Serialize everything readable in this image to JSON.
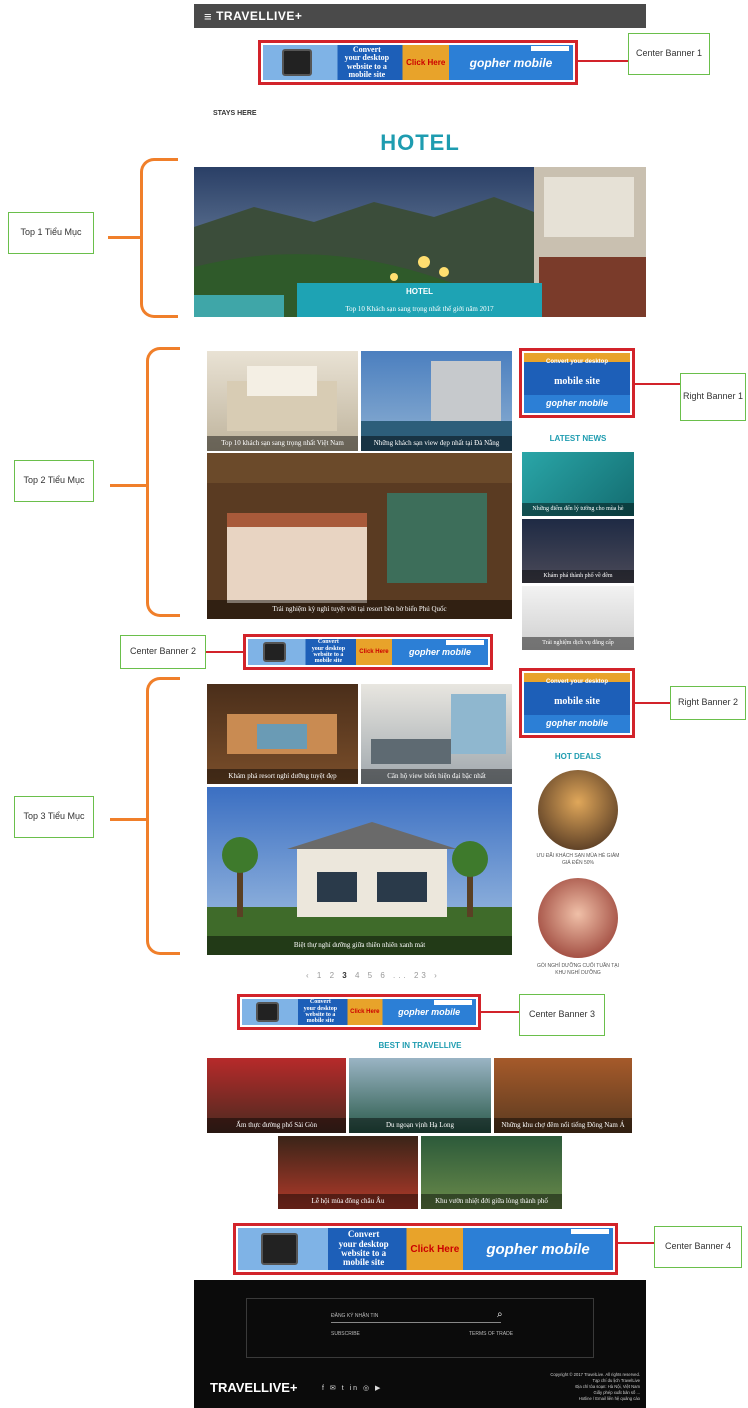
{
  "header": {
    "menu_icon": "hamburger-icon",
    "logo": "TRAVELLIVE+"
  },
  "banner": {
    "line1": "Convert",
    "line2": "your desktop",
    "line3": "website to a",
    "line4": "mobile site",
    "click": "Click Here",
    "brand": "gopher mobile"
  },
  "right_banner": {
    "line1": "Convert your desktop",
    "line2": "mobile site",
    "brand": "gopher mobile"
  },
  "callouts": {
    "center1": "Center Banner 1",
    "center2": "Center Banner 2",
    "center3": "Center Banner 3",
    "center4": "Center Banner 4",
    "right1": "Right Banner 1",
    "right2": "Right Banner 2",
    "top1": "Top 1 Tiểu Mục",
    "top2": "Top 2 Tiểu Mục",
    "top3": "Top 3 Tiểu Mục"
  },
  "section": {
    "breadcrumb": "STAYS HERE",
    "title": "HOTEL"
  },
  "hero": {
    "label": "HOTEL",
    "caption": "Top 10 Khách sạn sang trọng nhất thế giới năm 2017"
  },
  "top2": {
    "tile1": "Top 10 khách sạn sang trọng nhất Việt Nam",
    "tile2": "Những khách sạn view đẹp nhất tại Đà Nẵng",
    "tile3": "Trải nghiệm kỳ nghỉ tuyệt vời tại resort bên bờ biển Phú Quốc"
  },
  "latest": {
    "title": "LATEST NEWS",
    "item1": "Những điểm đến lý tưởng cho mùa hè",
    "item2": "Khám phá thành phố về đêm",
    "item3": "Trải nghiệm dịch vụ đẳng cấp"
  },
  "top3": {
    "tile1": "Khám phá resort nghỉ dưỡng tuyệt đẹp",
    "tile2": "Căn hộ view biển hiện đại bậc nhất",
    "tile3": "Biệt thự nghỉ dưỡng giữa thiên nhiên xanh mát"
  },
  "deals": {
    "title": "HOT DEALS",
    "item1": "ƯU ĐÃI KHÁCH SẠN MÙA HÈ GIẢM GIÁ ĐẾN 50%",
    "item2": "GÓI NGHỈ DƯỠNG CUỐI TUẦN TẠI KHU NGHỈ DƯỠNG"
  },
  "pager": {
    "prev": "‹",
    "p1": "1",
    "p2": "2",
    "p3": "3",
    "p4": "4",
    "p5": "5",
    "p6": "6",
    "dots": "...",
    "last": "23",
    "next": "›"
  },
  "best": {
    "title": "BEST IN TRAVELLIVE",
    "item1": "Ẩm thực đường phố Sài Gòn",
    "item2": "Du ngoạn vịnh Hạ Long",
    "item3": "Những khu chợ đêm nổi tiếng Đông Nam Á",
    "item4": "Lễ hội mùa đông châu Âu",
    "item5": "Khu vườn nhiệt đới giữa lòng thành phố"
  },
  "footer": {
    "search_placeholder": "ĐĂNG KÝ NHẬN TIN",
    "search_icon": "search-icon",
    "link1": "SUBSCRIBE",
    "link2": "TERMS OF TRADE",
    "logo": "TRAVELLIVE+",
    "social": "f ✉ t in ◎ ▶",
    "legal1": "Copyright © 2017 TravelLive. All rights reserved.",
    "legal2": "Tạp chí du lịch TravelLive",
    "legal3": "Địa chỉ tòa soạn: Hà Nội, Việt Nam",
    "legal4": "Giấy phép xuất bản số ...",
    "legal5": "Hotline / Email liên hệ quảng cáo"
  },
  "colors": {
    "accent": "#1e9cb0",
    "banner_border": "#d2232a",
    "bracket": "#f07f2a"
  }
}
